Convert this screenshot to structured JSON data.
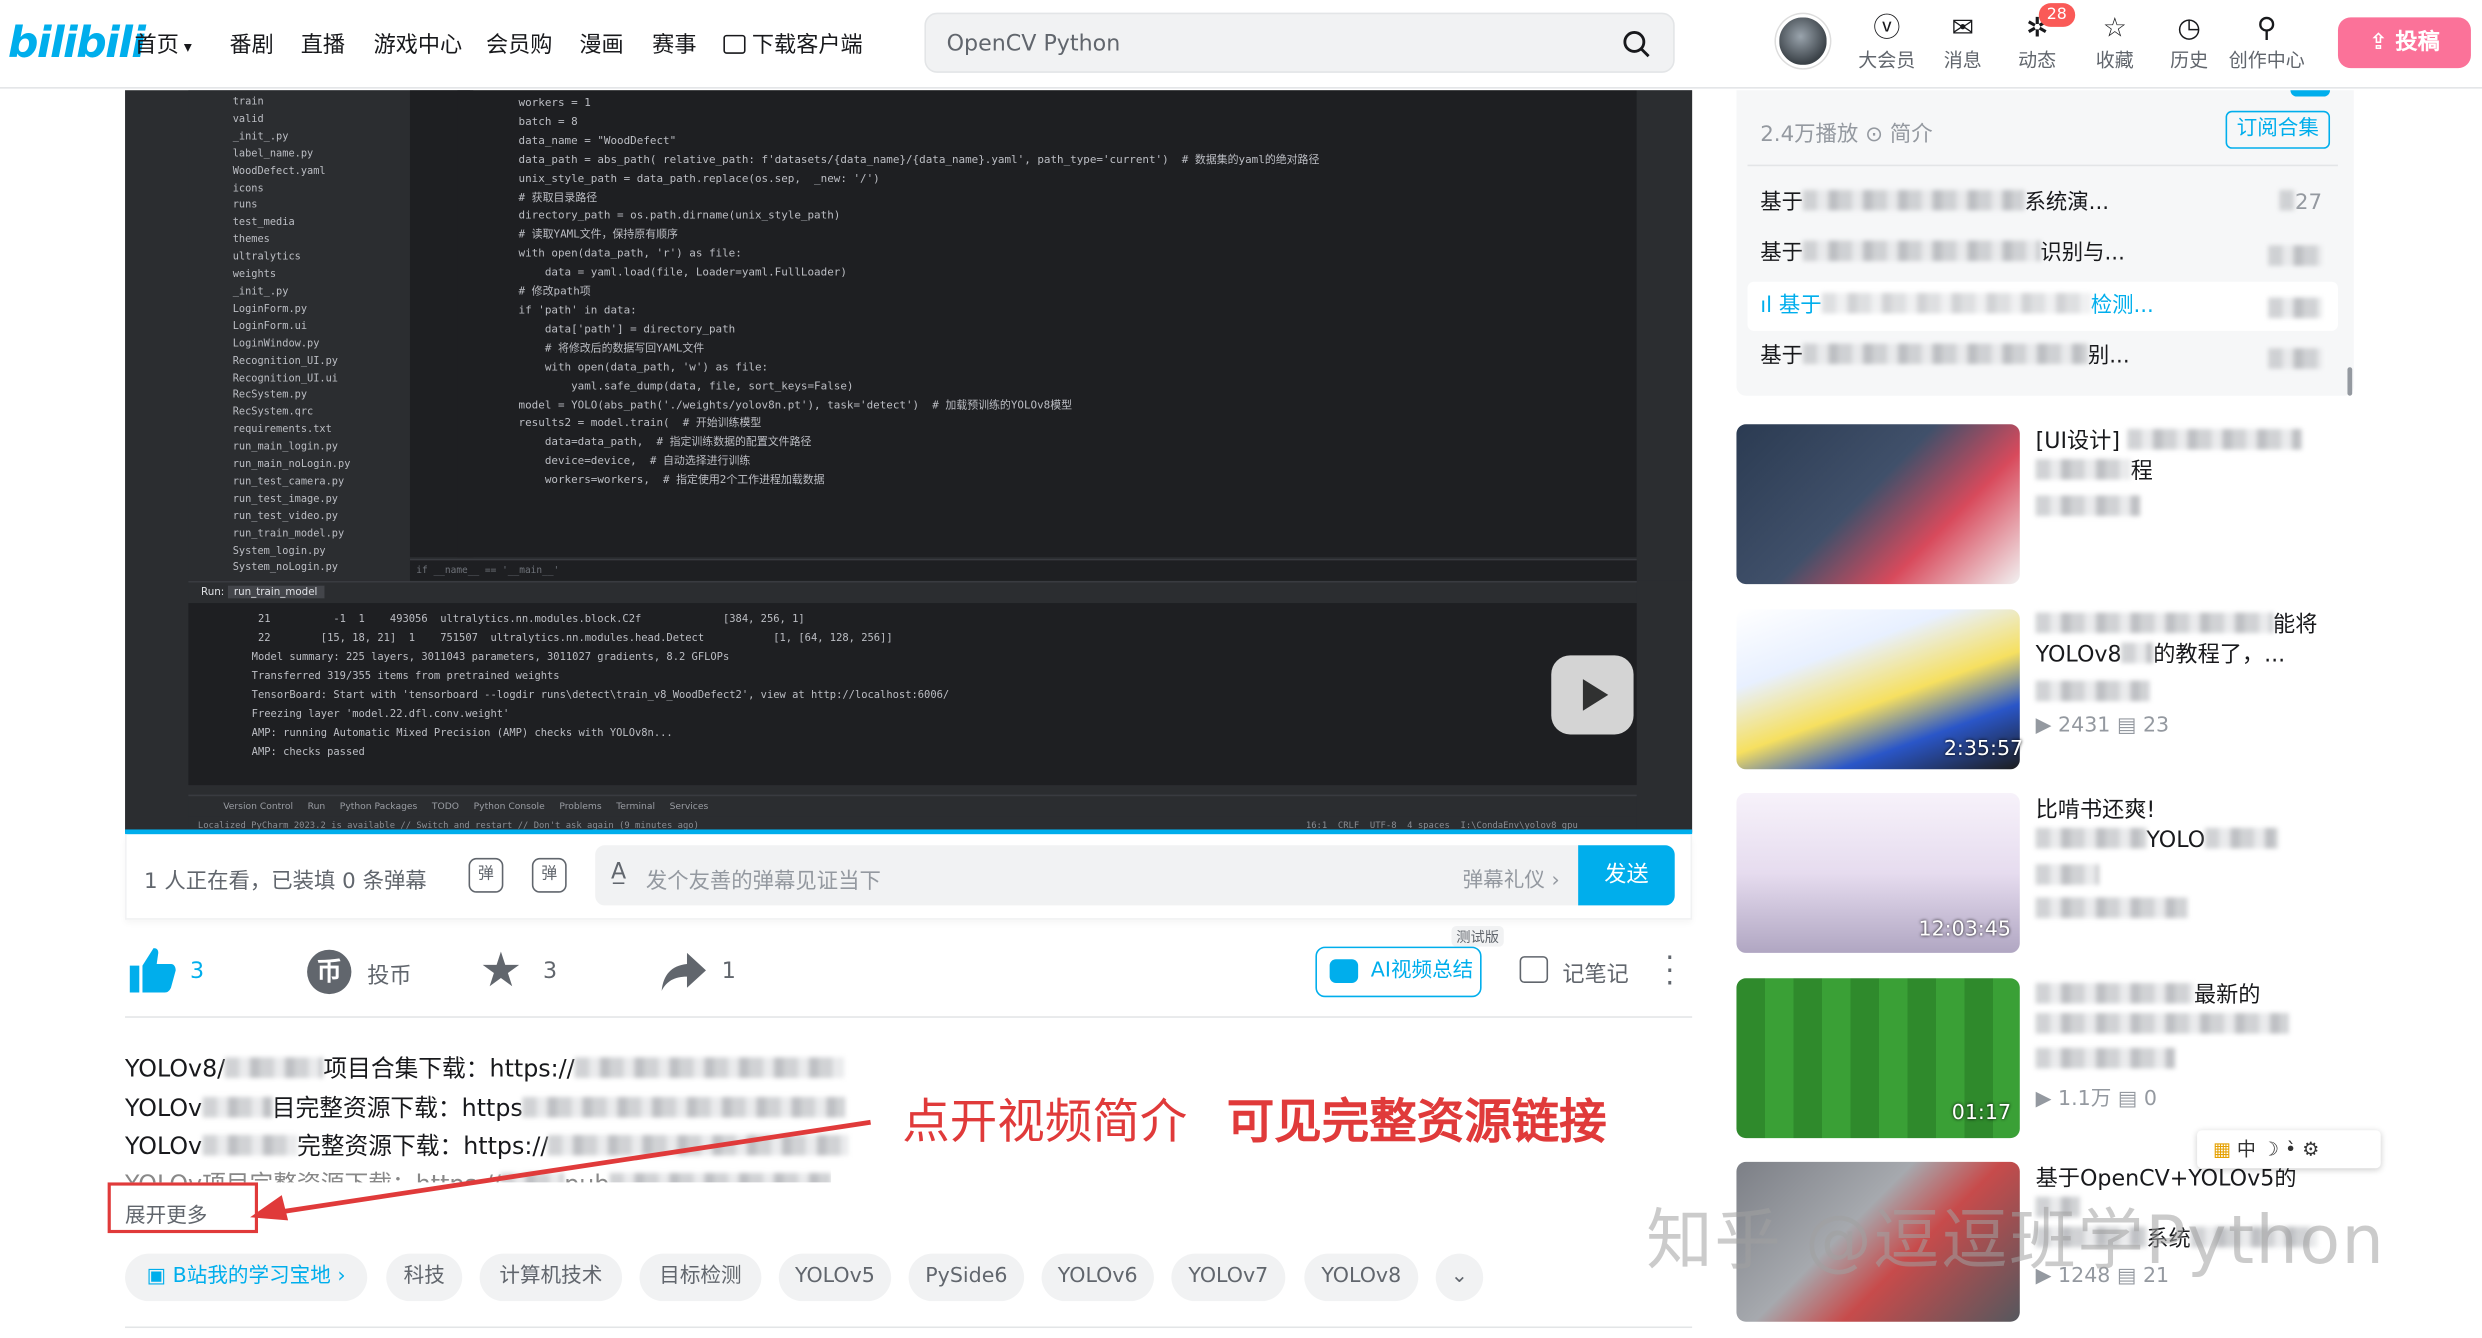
{
  "header": {
    "logo": "bilibili",
    "nav": [
      "首页",
      "番剧",
      "直播",
      "游戏中心",
      "会员购",
      "漫画",
      "赛事",
      "下载客户端"
    ],
    "search_placeholder": "OpenCV Python",
    "right_icons": [
      {
        "label": "大会员",
        "icon": "vip-icon"
      },
      {
        "label": "消息",
        "icon": "message-icon"
      },
      {
        "label": "动态",
        "icon": "dynamic-icon"
      },
      {
        "label": "收藏",
        "icon": "star-icon"
      },
      {
        "label": "历史",
        "icon": "clock-icon"
      },
      {
        "label": "创作中心",
        "icon": "bulb-icon"
      }
    ],
    "badge": "28",
    "upload": "投稿"
  },
  "video": {
    "filetree": [
      "train",
      "valid",
      "_init_.py",
      "label_name.py",
      "WoodDefect.yaml",
      "icons",
      "runs",
      "test_media",
      "themes",
      "ultralytics",
      "weights",
      "_init_.py",
      "LoginForm.py",
      "LoginForm.ui",
      "LoginWindow.py",
      "Recognition_UI.py",
      "Recognition_UI.ui",
      "RecSystem.py",
      "RecSystem.qrc",
      "requirements.txt",
      "run_main_login.py",
      "run_main_noLogin.py",
      "run_test_camera.py",
      "run_test_image.py",
      "run_test_video.py",
      "run_train_model.py",
      "System_login.py",
      "System_noLogin.py"
    ],
    "code": [
      "    workers = 1",
      "    batch = 8",
      "",
      "    data_name = \"WoodDefect\"",
      "    data_path = abs_path( relative_path: f'datasets/{data_name}/{data_name}.yaml', path_type='current')  # 数据集的yaml的绝对路径",
      "    unix_style_path = data_path.replace(os.sep,  _new: '/')",
      "",
      "    # 获取目录路径",
      "    directory_path = os.path.dirname(unix_style_path)",
      "    # 读取YAML文件，保持原有顺序",
      "    with open(data_path, 'r') as file:",
      "        data = yaml.load(file, Loader=yaml.FullLoader)",
      "    # 修改path项",
      "    if 'path' in data:",
      "        data['path'] = directory_path",
      "        # 将修改后的数据写回YAML文件",
      "        with open(data_path, 'w') as file:",
      "            yaml.safe_dump(data, file, sort_keys=False)",
      "",
      "    model = YOLO(abs_path('./weights/yolov8n.pt'), task='detect')  # 加载预训练的YOLOv8模型",
      "    results2 = model.train(  # 开始训练模型",
      "        data=data_path,  # 指定训练数据的配置文件路径",
      "        device=device,  # 自动选择进行训练",
      "        workers=workers,  # 指定使用2个工作进程加载数据"
    ],
    "run_tab": "run_train_model",
    "run_label": "Run:",
    "console": [
      " 21          -1  1    493056  ultralytics.nn.modules.block.C2f             [384, 256, 1]",
      " 22        [15, 18, 21]  1    751507  ultralytics.nn.modules.head.Detect           [1, [64, 128, 256]]",
      "Model summary: 225 layers, 3011043 parameters, 3011027 gradients, 8.2 GFLOPs",
      "",
      "Transferred 319/355 items from pretrained weights",
      "TensorBoard: Start with 'tensorboard --logdir runs\\detect\\train_v8_WoodDefect2', view at http://localhost:6006/",
      "Freezing layer 'model.22.dfl.conv.weight'",
      "AMP: running Automatic Mixed Precision (AMP) checks with YOLOv8n...",
      "AMP: checks passed"
    ],
    "bottom_tabs": [
      "Version Control",
      "Run",
      "Python Packages",
      "TODO",
      "Python Console",
      "Problems",
      "Terminal",
      "Services"
    ],
    "status_left": "Localized PyCharm 2023.2 is available // Switch and restart // Don't ask again (9 minutes ago)",
    "status_right": "16:1  CRLF  UTF-8  4 spaces  I:\\CondaEnv\\yolov8_gpu"
  },
  "danmaku": {
    "viewers": "1 人正在看，已装填 0 条弹幕",
    "placeholder": "发个友善的弹幕见证当下",
    "etiquette": "弹幕礼仪",
    "send": "发送"
  },
  "toolbar": {
    "like": "3",
    "coin": "投币",
    "fav": "3",
    "share": "1",
    "ai_summary": "AI视频总结",
    "beta": "测试版",
    "notes": "记笔记"
  },
  "description": {
    "lines": [
      "YOLOv8/",
      "项目合集下载：https://",
      "YOLOv",
      "目完整资源下载：https",
      "YOLOv",
      "完整资源下载：https://",
      "YOLOv",
      "项目完整资源下载：https://",
      "pub"
    ],
    "expand": "展开更多",
    "annotation_1": "点开视频简介",
    "annotation_2": "可见完整资源链接"
  },
  "tags": [
    "B站我的学习宝地",
    "科技",
    "计算机技术",
    "目标检测",
    "YOLOv5",
    "PySide6",
    "YOLOv6",
    "YOLOv7",
    "YOLOv8"
  ],
  "sidebar": {
    "plays": "2.4万播放",
    "intro": "简介",
    "subscribe": "订阅合集",
    "episodes": [
      {
        "prefix": "基于",
        "suffix": "系统演...",
        "dur": "27"
      },
      {
        "prefix": "基于",
        "suffix": "识别与...",
        "dur": ""
      },
      {
        "prefix": "基于",
        "suffix": "检测...",
        "dur": ""
      },
      {
        "prefix": "基于",
        "suffix": "别...",
        "dur": ""
      }
    ],
    "recs": [
      {
        "title": "[UI设计]",
        "title2": "程",
        "views": "",
        "danmaku": "",
        "dur": ""
      },
      {
        "title": "能将",
        "title2": "YOLOv8",
        "title3": "的教程了，...",
        "views": "2431",
        "danmaku": "23",
        "dur": "2:35:57"
      },
      {
        "title": "比啃书还爽!",
        "title2": "YOLO",
        "views": "",
        "danmaku": "",
        "dur": "12:03:45"
      },
      {
        "title": "最新的",
        "title2": "",
        "views": "1.1万",
        "danmaku": "0",
        "dur": "01:17"
      },
      {
        "title": "基于OpenCV+YOLOv5的",
        "title2": "系统",
        "views": "1248",
        "danmaku": "21",
        "dur": ""
      }
    ]
  },
  "watermark": "知乎 @逗逗班学Python",
  "ime_toolbar": "中"
}
